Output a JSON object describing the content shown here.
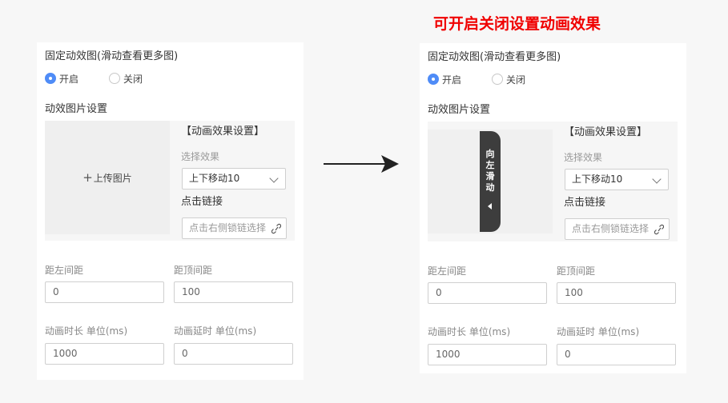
{
  "headline": "可开启关闭设置动画效果",
  "panels": {
    "left": {
      "section_title": "固定动效图(滑动查看更多图)",
      "radio_on": "开启",
      "radio_off": "关闭",
      "image_settings": "动效图片设置",
      "upload_plus": "+",
      "upload_label": "上传图片",
      "effect_title": "【动画效果设置】",
      "effect_label": "选择效果",
      "effect_value": "上下移动10",
      "link_label": "点击链接",
      "link_placeholder": "点击右侧锁链选择",
      "left_margin_label": "距左间距",
      "left_margin_value": "0",
      "top_margin_label": "距顶间距",
      "top_margin_value": "100",
      "duration_label": "动画时长 单位(ms)",
      "duration_value": "1000",
      "delay_label": "动画延时 单位(ms)",
      "delay_value": "0"
    },
    "right": {
      "section_title": "固定动效图(滑动查看更多图)",
      "radio_on": "开启",
      "radio_off": "关闭",
      "image_settings": "动效图片设置",
      "tab_text": "向左滑动",
      "effect_title": "【动画效果设置】",
      "effect_label": "选择效果",
      "effect_value": "上下移动10",
      "link_label": "点击链接",
      "link_placeholder": "点击右侧锁链选择",
      "left_margin_label": "距左间距",
      "left_margin_value": "0",
      "top_margin_label": "距顶间距",
      "top_margin_value": "100",
      "duration_label": "动画时长 单位(ms)",
      "duration_value": "1000",
      "delay_label": "动画延时 单位(ms)",
      "delay_value": "0"
    }
  },
  "colors": {
    "headline": "#f00000",
    "radio_accent": "#4f8cf7",
    "slide_tab": "#3d3d3d"
  },
  "icons": [
    "arrow-right-icon",
    "chevron-down-icon",
    "link-chain-icon",
    "caret-left-icon"
  ]
}
